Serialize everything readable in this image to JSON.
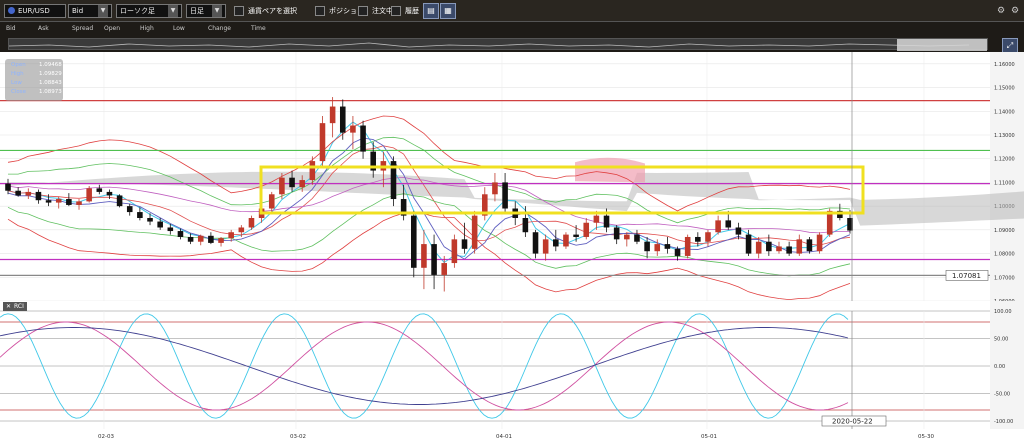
{
  "toolbar": {
    "symbol": "EUR/USD",
    "price_type": "Bid",
    "chart_type": "ローソク足",
    "timeframe": "日足",
    "link_pair_label": "通貨ペアを選択",
    "position_label": "ポジション",
    "order_label": "注文中",
    "history_label": "履歴",
    "btn1_icon": "▤",
    "btn2_icon": "▦",
    "settings_icon": "⚙",
    "refresh_icon": "⚙"
  },
  "legend": [
    "Bid",
    "Ask",
    "Spread",
    "Open",
    "High",
    "Low",
    "Change",
    "Time"
  ],
  "ohlc": {
    "open_label": "Open",
    "open_value": "1.09468",
    "high_label": "High",
    "high_value": "1.09829",
    "low_label": "Low",
    "low_value": "1.08843",
    "close_label": "Close",
    "close_value": "1.08973"
  },
  "price_axis": {
    "ticks": [
      "1.16000",
      "1.15000",
      "1.14000",
      "1.13000",
      "1.12000",
      "1.11000",
      "1.10000",
      "1.09000",
      "1.08000",
      "1.07000",
      "1.06000"
    ],
    "current_badge": "1.07081"
  },
  "rci": {
    "label": "RCI",
    "ticks": [
      "100.00",
      "50.00",
      "0.00",
      "-50.00",
      "-100.00"
    ],
    "date_badge": "2020-05-22"
  },
  "x_ticks": [
    "02-03",
    "03-02",
    "04-01",
    "05-01",
    "05-30"
  ],
  "chart_data": {
    "type": "candlestick",
    "symbol": "EUR/USD",
    "timeframe": "日足",
    "ylim": [
      1.06,
      1.165
    ],
    "horizontal_lines": [
      {
        "value": 1.1445,
        "color": "#d04040"
      },
      {
        "value": 1.1235,
        "color": "#50c050"
      },
      {
        "value": 1.1095,
        "color": "#c030c0"
      },
      {
        "value": 1.0775,
        "color": "#c030c0"
      },
      {
        "value": 1.0708,
        "color": "#888888"
      }
    ],
    "candles": [
      [
        1.1095,
        1.1115,
        1.105,
        1.1065
      ],
      [
        1.1065,
        1.108,
        1.104,
        1.1045
      ],
      [
        1.1045,
        1.1075,
        1.103,
        1.106
      ],
      [
        1.106,
        1.107,
        1.101,
        1.1025
      ],
      [
        1.1025,
        1.105,
        1.1,
        1.1015
      ],
      [
        1.1015,
        1.104,
        1.099,
        1.103
      ],
      [
        1.103,
        1.1055,
        1.1,
        1.1005
      ],
      [
        1.1005,
        1.103,
        1.0985,
        1.102
      ],
      [
        1.102,
        1.1085,
        1.1015,
        1.1075
      ],
      [
        1.1075,
        1.109,
        1.105,
        1.106
      ],
      [
        1.106,
        1.107,
        1.103,
        1.1045
      ],
      [
        1.1045,
        1.105,
        1.0995,
        1.1
      ],
      [
        1.1,
        1.101,
        1.096,
        1.0975
      ],
      [
        1.0975,
        1.0995,
        1.094,
        1.095
      ],
      [
        1.095,
        1.097,
        1.092,
        1.0935
      ],
      [
        1.0935,
        1.095,
        1.09,
        1.091
      ],
      [
        1.091,
        1.0925,
        1.088,
        1.0895
      ],
      [
        1.0895,
        1.0905,
        1.086,
        1.087
      ],
      [
        1.087,
        1.0885,
        1.084,
        1.085
      ],
      [
        1.085,
        1.088,
        1.0835,
        1.0875
      ],
      [
        1.0875,
        1.089,
        1.084,
        1.0845
      ],
      [
        1.0845,
        1.087,
        1.083,
        1.0865
      ],
      [
        1.0865,
        1.09,
        1.085,
        1.089
      ],
      [
        1.089,
        1.092,
        1.087,
        1.091
      ],
      [
        1.091,
        1.096,
        1.09,
        1.095
      ],
      [
        1.095,
        1.1,
        1.093,
        1.099
      ],
      [
        1.099,
        1.106,
        1.097,
        1.105
      ],
      [
        1.105,
        1.114,
        1.103,
        1.112
      ],
      [
        1.112,
        1.115,
        1.106,
        1.108
      ],
      [
        1.108,
        1.113,
        1.106,
        1.111
      ],
      [
        1.111,
        1.121,
        1.109,
        1.119
      ],
      [
        1.119,
        1.138,
        1.117,
        1.135
      ],
      [
        1.135,
        1.146,
        1.129,
        1.142
      ],
      [
        1.142,
        1.145,
        1.128,
        1.131
      ],
      [
        1.131,
        1.138,
        1.124,
        1.134
      ],
      [
        1.134,
        1.136,
        1.12,
        1.123
      ],
      [
        1.123,
        1.127,
        1.112,
        1.115
      ],
      [
        1.115,
        1.123,
        1.108,
        1.119
      ],
      [
        1.119,
        1.121,
        1.1,
        1.103
      ],
      [
        1.103,
        1.109,
        1.094,
        1.096
      ],
      [
        1.096,
        1.098,
        1.07,
        1.074
      ],
      [
        1.074,
        1.09,
        1.065,
        1.084
      ],
      [
        1.084,
        1.088,
        1.065,
        1.071
      ],
      [
        1.071,
        1.079,
        1.064,
        1.076
      ],
      [
        1.076,
        1.088,
        1.074,
        1.086
      ],
      [
        1.086,
        1.093,
        1.08,
        1.082
      ],
      [
        1.082,
        1.098,
        1.08,
        1.096
      ],
      [
        1.096,
        1.108,
        1.094,
        1.105
      ],
      [
        1.105,
        1.114,
        1.102,
        1.11
      ],
      [
        1.11,
        1.114,
        1.097,
        1.099
      ],
      [
        1.099,
        1.102,
        1.092,
        1.095
      ],
      [
        1.095,
        1.1,
        1.087,
        1.089
      ],
      [
        1.089,
        1.09,
        1.078,
        1.08
      ],
      [
        1.08,
        1.088,
        1.077,
        1.086
      ],
      [
        1.086,
        1.09,
        1.081,
        1.083
      ],
      [
        1.083,
        1.089,
        1.082,
        1.088
      ],
      [
        1.088,
        1.092,
        1.085,
        1.087
      ],
      [
        1.087,
        1.095,
        1.086,
        1.093
      ],
      [
        1.093,
        1.098,
        1.09,
        1.096
      ],
      [
        1.096,
        1.099,
        1.089,
        1.091
      ],
      [
        1.091,
        1.092,
        1.084,
        1.086
      ],
      [
        1.086,
        1.089,
        1.083,
        1.088
      ],
      [
        1.088,
        1.09,
        1.084,
        1.085
      ],
      [
        1.085,
        1.087,
        1.078,
        1.081
      ],
      [
        1.081,
        1.086,
        1.079,
        1.084
      ],
      [
        1.084,
        1.087,
        1.08,
        1.082
      ],
      [
        1.082,
        1.083,
        1.077,
        1.079
      ],
      [
        1.079,
        1.088,
        1.078,
        1.087
      ],
      [
        1.087,
        1.089,
        1.083,
        1.085
      ],
      [
        1.085,
        1.09,
        1.083,
        1.089
      ],
      [
        1.089,
        1.096,
        1.088,
        1.094
      ],
      [
        1.094,
        1.098,
        1.09,
        1.091
      ],
      [
        1.091,
        1.093,
        1.086,
        1.088
      ],
      [
        1.088,
        1.09,
        1.079,
        1.08
      ],
      [
        1.08,
        1.087,
        1.078,
        1.085
      ],
      [
        1.085,
        1.088,
        1.079,
        1.081
      ],
      [
        1.081,
        1.085,
        1.08,
        1.083
      ],
      [
        1.083,
        1.085,
        1.079,
        1.08
      ],
      [
        1.08,
        1.088,
        1.079,
        1.086
      ],
      [
        1.086,
        1.087,
        1.08,
        1.081
      ],
      [
        1.081,
        1.089,
        1.08,
        1.088
      ],
      [
        1.088,
        1.099,
        1.087,
        1.098
      ],
      [
        1.098,
        1.101,
        1.094,
        1.095
      ],
      [
        1.095,
        1.0983,
        1.0884,
        1.0897
      ]
    ]
  }
}
